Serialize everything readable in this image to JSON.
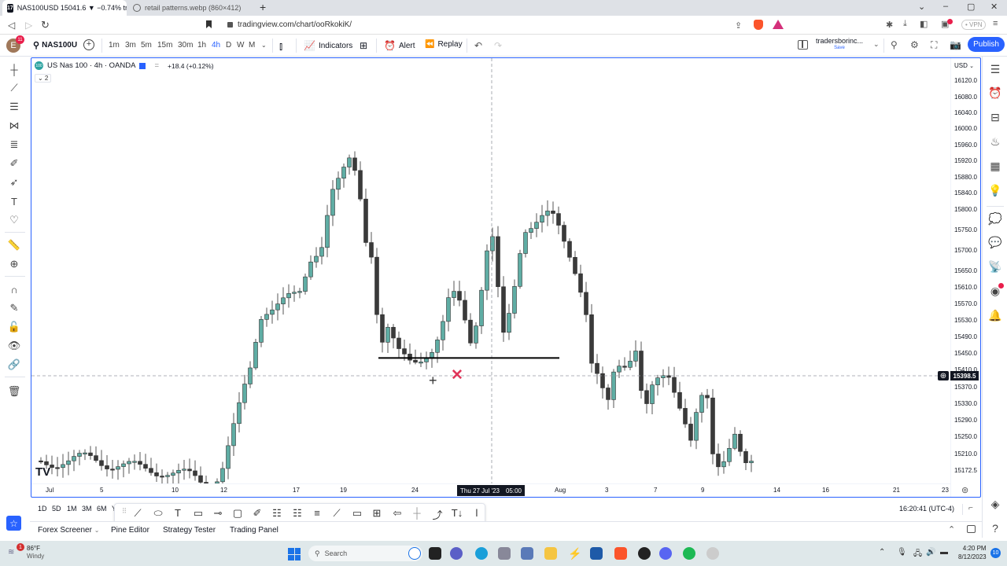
{
  "browser": {
    "tabs": [
      {
        "title": "NAS100USD 15041.6 ▼ −0.74% tr",
        "active": true
      },
      {
        "title": "retail patterns.webp (860×412)",
        "active": false
      }
    ],
    "new_tab": "+",
    "url": "tradingview.com/chart/ooRkokiK/",
    "vpn_label": "• VPN",
    "window_controls": [
      "⌄",
      "–",
      "▢",
      "✕"
    ]
  },
  "toolbar": {
    "avatar_letter": "E",
    "avatar_badge": "11",
    "symbol": "NAS100U",
    "timeframes": [
      "1m",
      "3m",
      "5m",
      "15m",
      "30m",
      "1h",
      "4h",
      "D",
      "W",
      "M"
    ],
    "selected_timeframe": "4h",
    "indicators_label": "Indicators",
    "alert_label": "Alert",
    "replay_label": "Replay",
    "layout_name": "tradersborinc...",
    "save_label": "Save",
    "publish_label": "Publish"
  },
  "chart": {
    "legend_title": "US Nas 100 · 4h · OANDA",
    "legend_change": "+18.4 (+0.12%)",
    "logo_text": "100",
    "collapse_label": "⌄ 2",
    "currency": "USD",
    "price_labels": [
      "16120.0",
      "16080.0",
      "16040.0",
      "16000.0",
      "15960.0",
      "15920.0",
      "15880.0",
      "15840.0",
      "15800.0",
      "15750.0",
      "15700.0",
      "15650.0",
      "15610.0",
      "15570.0",
      "15530.0",
      "15490.0",
      "15450.0",
      "15410.0",
      "15370.0",
      "15330.0",
      "15290.0",
      "15250.0",
      "15210.0",
      "15172.5"
    ],
    "current_price": "15398.5",
    "time_labels": [
      "Jul",
      "5",
      "10",
      "12",
      "17",
      "19",
      "24",
      "Aug",
      "3",
      "7",
      "9",
      "14",
      "16",
      "21",
      "23"
    ],
    "crosshair_date": "Thu 27 Jul '23",
    "crosshair_time": "05:00",
    "horizontal_line_price": 15445,
    "colors": {
      "up": "#5fada4",
      "down": "#3a3a3a",
      "line": "#000000",
      "cross_mark": "#e0355a"
    }
  },
  "chart_data": {
    "type": "candlestick",
    "title": "US Nas 100 · 4h · OANDA",
    "ylim": [
      15150,
      16150
    ],
    "annotations": [
      "horizontal support line ~15445",
      "red X mark below support",
      "crosshair at Thu 27 Jul '23 05:00, 15398.5"
    ],
    "description": "Price rallies from ~15170 in early July to a peak near 15940 around 19 Jul, drops to ~15445 support around 24 Jul, rallies to ~15800 near Aug 1, then declines below 15200 by 9-10 Aug."
  },
  "range_bar": {
    "ranges": [
      "1D",
      "5D",
      "1M",
      "3M",
      "6M",
      "Y"
    ],
    "clock": "16:20:41 (UTC-4)"
  },
  "panel_tabs": [
    "Forex Screener",
    "Pine Editor",
    "Strategy Tester",
    "Trading Panel"
  ],
  "taskbar": {
    "weather_temp": "86°F",
    "weather_desc": "Windy",
    "weather_badge": "1",
    "search_placeholder": "Search",
    "time": "4:20 PM",
    "date": "8/12/2023",
    "notifications": "10"
  }
}
